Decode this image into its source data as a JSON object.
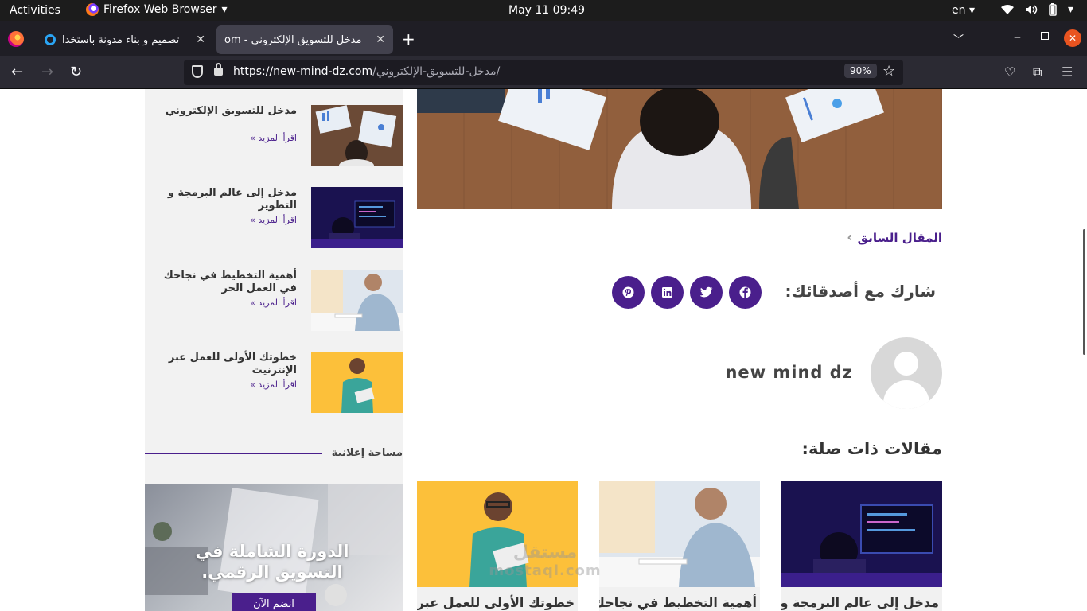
{
  "topbar": {
    "activities": "Activities",
    "app_name": "Firefox Web Browser",
    "clock": "May 11  09:49",
    "lang": "en",
    "tray_icons": [
      "wifi-icon",
      "volume-icon",
      "battery-icon",
      "chevron-down-icon"
    ]
  },
  "tabs": [
    {
      "title": "تصميم و بناء مدونة باستخدا",
      "active": false
    },
    {
      "title": "مدخل للتسويق الإلكتروني - om",
      "active": true
    }
  ],
  "navbar": {
    "url_host": "https://new-mind-dz.com",
    "url_path": "/مدخل-للتسويق-الإلكتروني/",
    "zoom": "90%"
  },
  "sidebar": {
    "posts": [
      {
        "title": "مدخل للتسويق الإلكتروني",
        "more": "اقرأ المزيد »"
      },
      {
        "title": "مدخل إلى عالم البرمجة و التطوير",
        "more": "اقرأ المزيد »"
      },
      {
        "title": "أهمية التخطيط في نجاحك في العمل الحر",
        "more": "اقرأ المزيد »"
      },
      {
        "title": "خطوتك الأولى للعمل عبر الإنترنيت",
        "more": "اقرأ المزيد »"
      }
    ],
    "ad_heading": "مساحة إعلانية",
    "ad_title": "الدورة الشاملة في التسويق الرقمي.",
    "ad_button": "انضم الآن"
  },
  "article": {
    "prev_label": "المقال السابق",
    "share_label": "شارك مع أصدقائك:",
    "share_buttons": [
      "facebook-icon",
      "twitter-icon",
      "linkedin-icon",
      "pinterest-icon"
    ],
    "author_name": "new mind dz",
    "related_title": "مقالات ذات صلة:",
    "related": [
      {
        "title": "مدخل إلى عالم البرمجة و"
      },
      {
        "title": "أهمية التخطيط في نجاحك"
      },
      {
        "title": "خطوتك الأولى للعمل عبر"
      }
    ]
  },
  "watermark": {
    "line1": "مستقل",
    "line2": "mostaql.com"
  },
  "colors": {
    "accent": "#4a1f8c",
    "topbar": "#1c1c1c",
    "tabstrip": "#1f1e25",
    "navbar": "#2b2a33"
  }
}
